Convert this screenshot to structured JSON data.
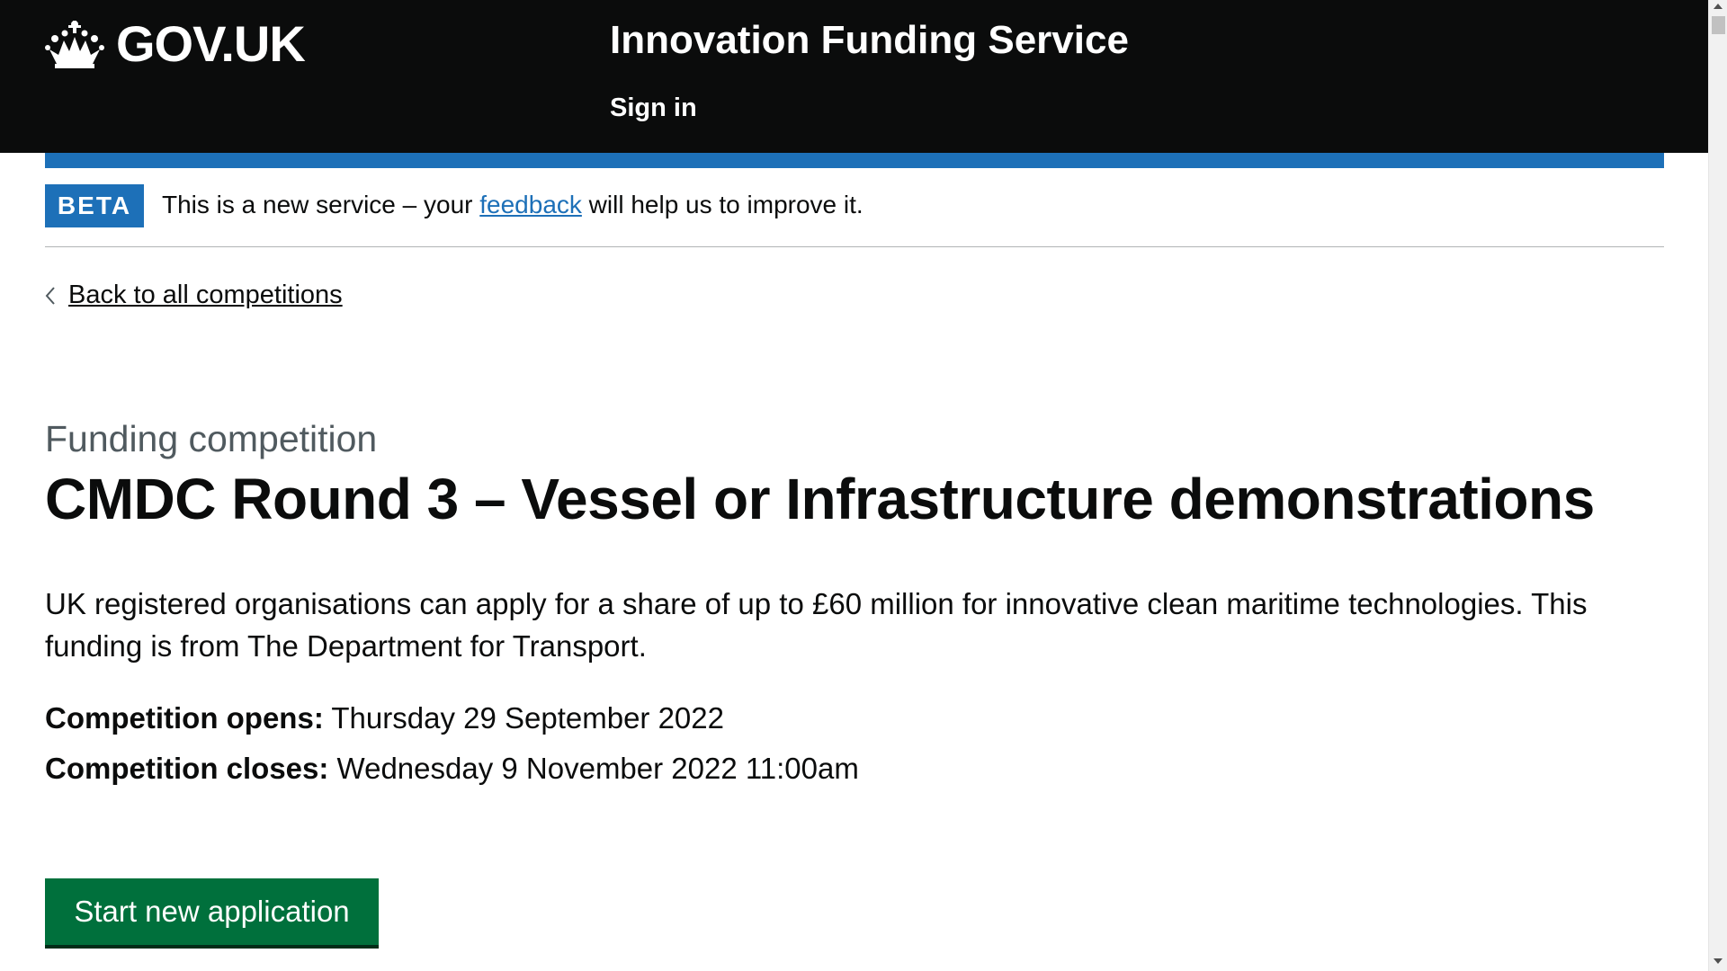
{
  "header": {
    "logo_text": "GOV.UK",
    "service_name": "Innovation Funding Service",
    "sign_in": "Sign in"
  },
  "phase_banner": {
    "tag": "BETA",
    "text_before": "This is a new service – your",
    "link": "feedback",
    "text_after": "will help us to improve it."
  },
  "back_link": "Back to all competitions",
  "competition": {
    "caption": "Funding competition",
    "title": "CMDC Round 3 – Vessel or Infrastructure demonstrations",
    "description": "UK registered organisations can apply for a share of up to £60 million for innovative clean maritime technologies. This funding is from The Department for Transport.",
    "opens_label": "Competition opens:",
    "opens_value": "Thursday 29 September 2022",
    "closes_label": "Competition closes:",
    "closes_value": "Wednesday 9 November 2022 11:00am"
  },
  "start_button": "Start new application",
  "colors": {
    "header_bg": "#0b0c0c",
    "brand_blue": "#1d70b8",
    "button_green": "#00703c"
  }
}
